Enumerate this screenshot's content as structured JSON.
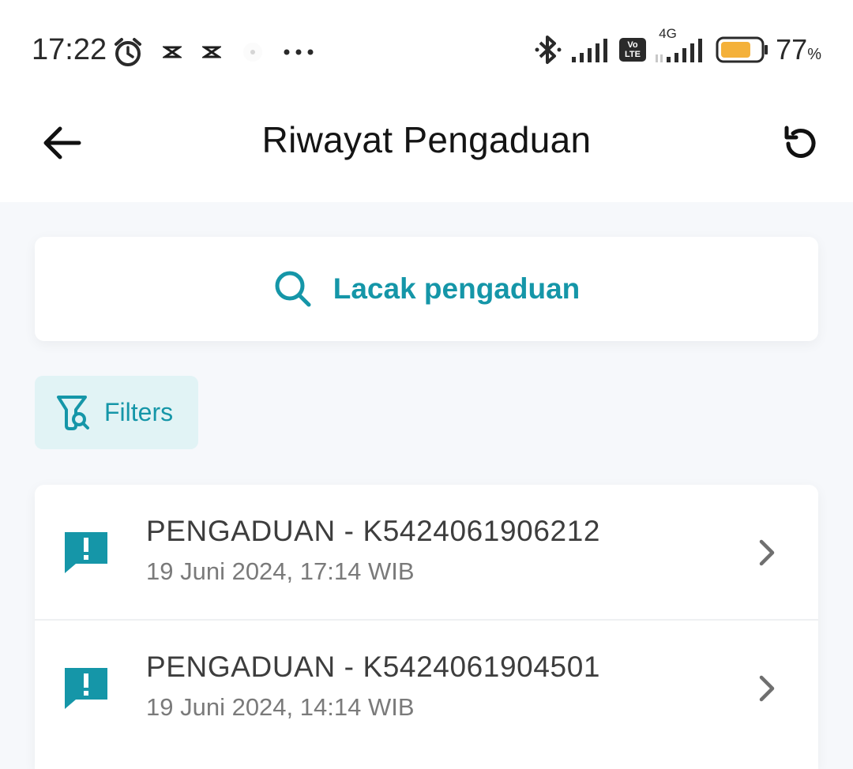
{
  "status_bar": {
    "time": "17:22",
    "network_label": "4G",
    "volte_label": "Vo LTE",
    "battery_percent": "77",
    "battery_unit": "%",
    "battery_level": 0.77,
    "icons": [
      "alarm-icon",
      "capcut-icon",
      "capcut-icon",
      "notification-icon",
      "more-icon",
      "bluetooth-icon",
      "signal-icon",
      "volte-icon",
      "signal-icon",
      "battery-icon"
    ]
  },
  "app_bar": {
    "title": "Riwayat Pengaduan",
    "back_icon": "arrow-left-icon",
    "refresh_icon": "refresh-icon"
  },
  "search": {
    "label": "Lacak pengaduan",
    "icon": "search-icon"
  },
  "filter": {
    "label": "Filters",
    "icon": "filter-search-icon"
  },
  "complaints": [
    {
      "title": "PENGADUAN - K5424061906212",
      "date": "19 Juni 2024, 17:14 WIB"
    },
    {
      "title": "PENGADUAN - K5424061904501",
      "date": "19 Juni 2024, 14:14 WIB"
    }
  ],
  "colors": {
    "accent": "#1596a8",
    "filter_bg": "#e1f3f5",
    "page_bg": "#f6f8fb",
    "battery_fill": "#f4b13a"
  }
}
